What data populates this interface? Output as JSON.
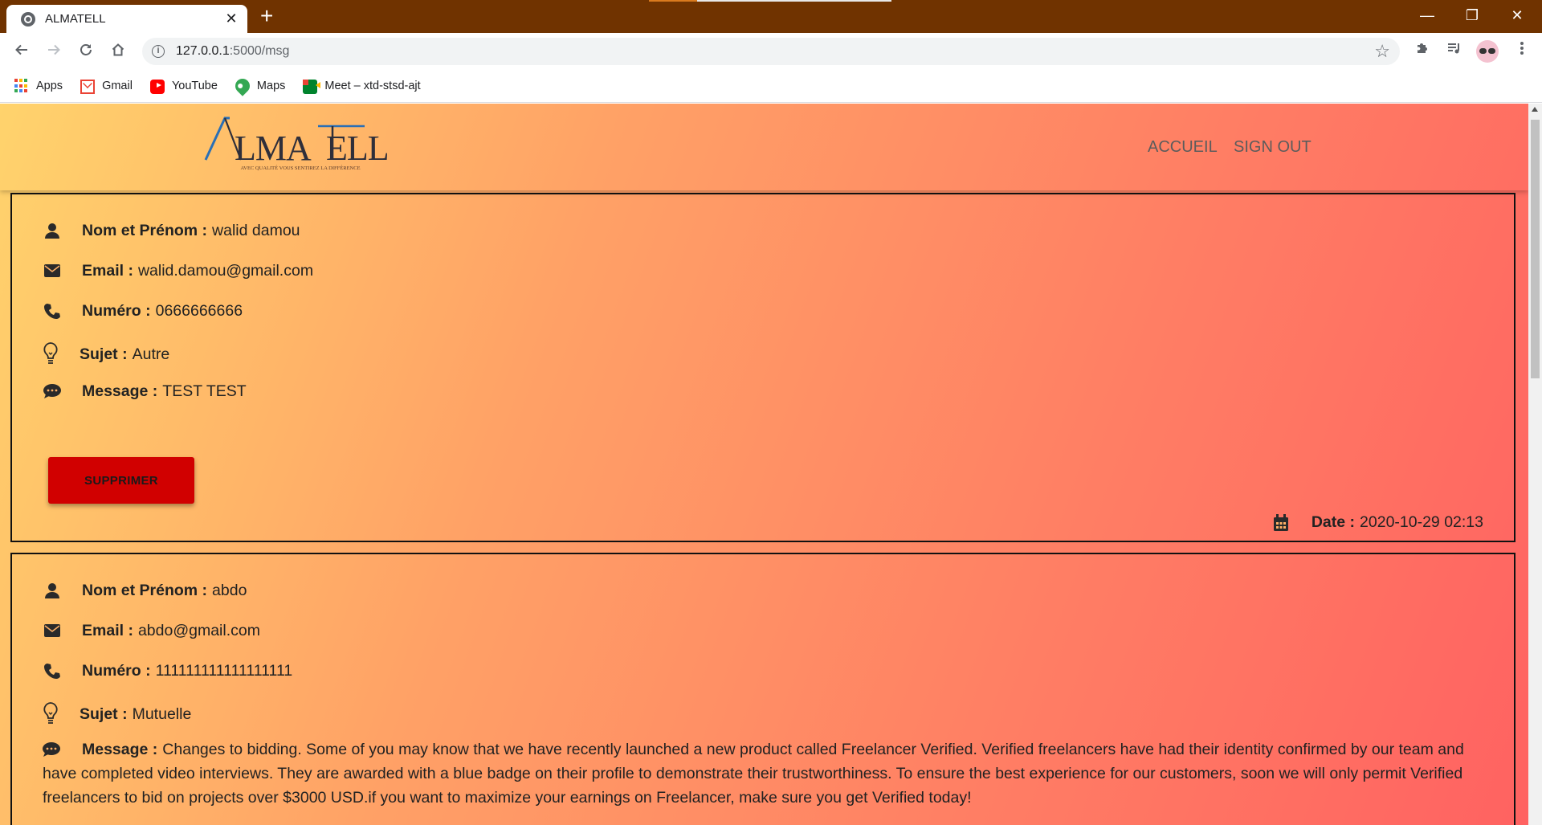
{
  "browser": {
    "tab_title": "ALMATELL",
    "tab_close": "✕",
    "new_tab": "+",
    "url_host": "127.0.0.1",
    "url_rest": ":5000/msg",
    "window_controls": {
      "minimize": "—",
      "restore": "❐",
      "close": "✕"
    },
    "bookmarks": [
      {
        "label": "Apps",
        "icon": "apps-grid-icon"
      },
      {
        "label": "Gmail",
        "icon": "gmail-icon"
      },
      {
        "label": "YouTube",
        "icon": "youtube-icon"
      },
      {
        "label": "Maps",
        "icon": "maps-icon"
      },
      {
        "label": "Meet – xtd-stsd-ajt",
        "icon": "meet-icon"
      }
    ]
  },
  "site": {
    "logo_text": "ALMATELL",
    "logo_tagline": "AVEC QUALITÉ VOUS SENTIREZ LA DIFFÉRENCE",
    "nav": {
      "home": "ACCUEIL",
      "signout": "SIGN OUT"
    },
    "colors": {
      "gradient_start": "#ffd36c",
      "gradient_end": "#ff6261",
      "delete_button": "#d10000",
      "logo_blue": "#2a6fb5"
    }
  },
  "labels": {
    "name": "Nom et Prénom :",
    "email": "Email :",
    "phone": "Numéro :",
    "subject": "Sujet :",
    "message": "Message :",
    "date": "Date :",
    "delete": "SUPPRIMER"
  },
  "messages": [
    {
      "name": "walid damou",
      "email": "walid.damou@gmail.com",
      "phone": "0666666666",
      "subject": "Autre",
      "message": "TEST TEST",
      "date": "2020-10-29 02:13"
    },
    {
      "name": "abdo",
      "email": "abdo@gmail.com",
      "phone": "111111111111111111",
      "subject": "Mutuelle",
      "message": "Changes to bidding. Some of you may know that we have recently launched a new product called Freelancer Verified. Verified freelancers have had their identity confirmed by our team and have completed video interviews. They are awarded with a blue badge on their profile to demonstrate their trustworthiness. To ensure the best experience for our customers, soon we will only permit Verified freelancers to bid on projects over $3000 USD.if you want to maximize your earnings on Freelancer, make sure you get Verified today!"
    }
  ]
}
